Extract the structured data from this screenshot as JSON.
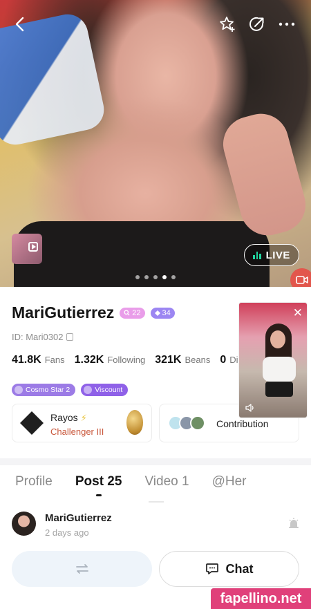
{
  "hero": {
    "live_label": "LIVE",
    "carousel": {
      "count": 5,
      "active_index": 3
    }
  },
  "top_bar": {
    "icons": [
      "back-icon",
      "star-add-icon",
      "share-icon",
      "more-icon"
    ]
  },
  "profile": {
    "name": "MariGutierrez",
    "level_badge": "22",
    "gem_badge": "34",
    "id_text": "ID: Mari0302",
    "stats": [
      {
        "value": "41.8K",
        "label": "Fans"
      },
      {
        "value": "1.32K",
        "label": "Following"
      },
      {
        "value": "321K",
        "label": "Beans"
      },
      {
        "value": "0",
        "label": "Diamonds"
      }
    ],
    "tags": [
      "Cosmo Star 2",
      "Viscount"
    ],
    "family_card": {
      "name": "Rayos",
      "rank": "Challenger III"
    },
    "contribution_label": "Contribution"
  },
  "tabs": [
    "Profile",
    "Post 25",
    "Video 1",
    "@Her"
  ],
  "active_tab": "Post 25",
  "post": {
    "author": "MariGutierrez",
    "time": "2 days ago"
  },
  "bottom_bar": {
    "chat_label": "Chat"
  },
  "watermark": "fapellino.net",
  "colors": {
    "live_accent": "#20d6a0",
    "pink_badge": "#e99de9",
    "purple_badge": "#9c86f2",
    "rank_text": "#c9573b",
    "watermark_bg": "#e0407a"
  }
}
